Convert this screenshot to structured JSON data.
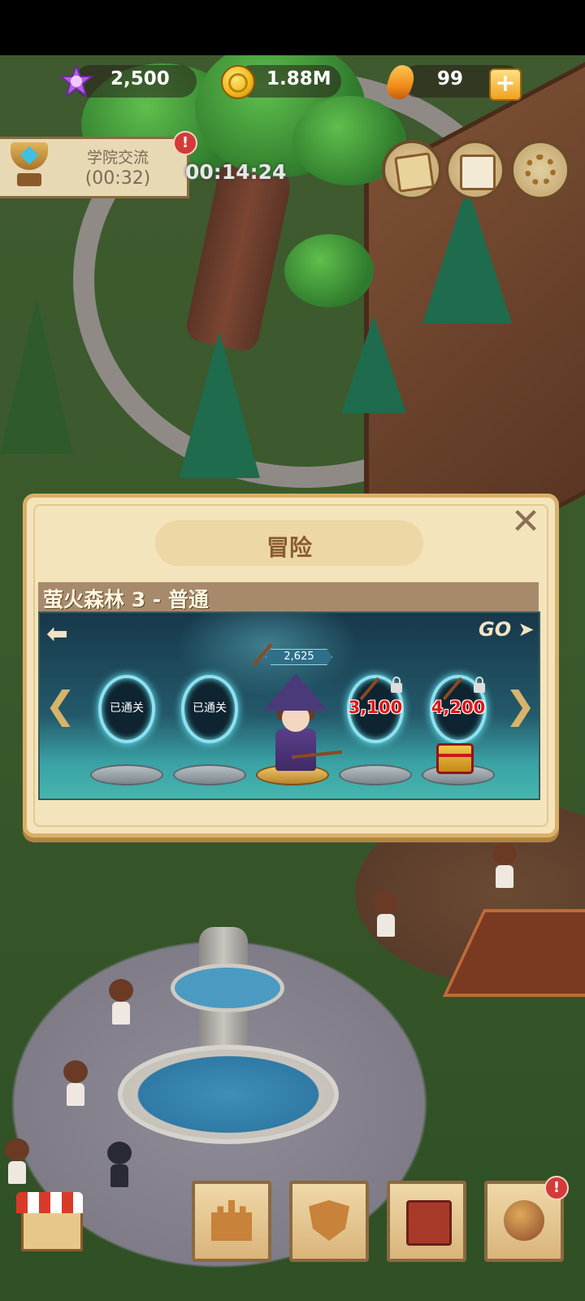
{
  "currencies": {
    "gems": "2,500",
    "coins": "1.88M",
    "amber": "99"
  },
  "event": {
    "title": "学院交流",
    "countdown": "(00:32)",
    "alert": "!"
  },
  "world_timer": "00:14:24",
  "adventure": {
    "title": "冒险",
    "close": "✕",
    "level_name": "萤火森林 3 - 普通",
    "back_label": "⬅",
    "go_label": "GO ➤",
    "prev_arrow": "❮",
    "next_arrow": "❯",
    "hero_power": "2,625",
    "stages": [
      {
        "label": "已通关",
        "status": "cleared"
      },
      {
        "label": "已通关",
        "status": "cleared"
      },
      {
        "label": "",
        "status": "current"
      },
      {
        "label": "3,100",
        "status": "locked"
      },
      {
        "label": "4,200",
        "status": "locked"
      }
    ]
  },
  "bottom_menu": {
    "alert": "!",
    "items": [
      "castle-icon",
      "shield-icon",
      "skull-book-icon",
      "planet-icon"
    ]
  },
  "colors": {
    "dialog_bg": "#f4e4bc",
    "locked_cost": "#e31515",
    "title": "#8b5a32"
  }
}
